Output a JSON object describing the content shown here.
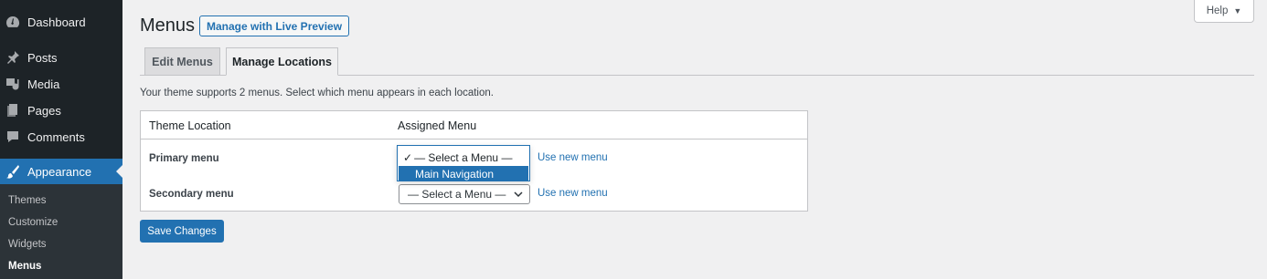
{
  "sidebar": {
    "items": [
      {
        "label": "Dashboard",
        "icon": "dashboard-icon"
      },
      {
        "label": "Posts",
        "icon": "pin-icon"
      },
      {
        "label": "Media",
        "icon": "media-icon"
      },
      {
        "label": "Pages",
        "icon": "page-icon"
      },
      {
        "label": "Comments",
        "icon": "comment-icon"
      },
      {
        "label": "Appearance",
        "icon": "brush-icon",
        "active": true
      }
    ],
    "submenu": [
      "Themes",
      "Customize",
      "Widgets",
      "Menus"
    ],
    "current_submenu": "Menus"
  },
  "header": {
    "title": "Menus",
    "live_preview_label": "Manage with Live Preview",
    "help_label": "Help"
  },
  "tabs": [
    {
      "label": "Edit Menus",
      "active": false
    },
    {
      "label": "Manage Locations",
      "active": true
    }
  ],
  "intro_text": "Your theme supports 2 menus. Select which menu appears in each location.",
  "locations_table": {
    "columns": [
      "Theme Location",
      "Assigned Menu"
    ],
    "rows": [
      {
        "location": "Primary menu",
        "selected": "— Select a Menu —",
        "link": "Use new menu"
      },
      {
        "location": "Secondary menu",
        "selected": "— Select a Menu —",
        "link": "Use new menu"
      }
    ]
  },
  "open_dropdown": {
    "options": [
      "— Select a Menu —",
      "Main Navigation"
    ],
    "checked": "— Select a Menu —",
    "highlighted": "Main Navigation",
    "check_mark": "✓"
  },
  "save_label": "Save Changes",
  "colors": {
    "sidebar_bg": "#1d2327",
    "accent": "#2271b1",
    "page_bg": "#f0f0f1"
  }
}
